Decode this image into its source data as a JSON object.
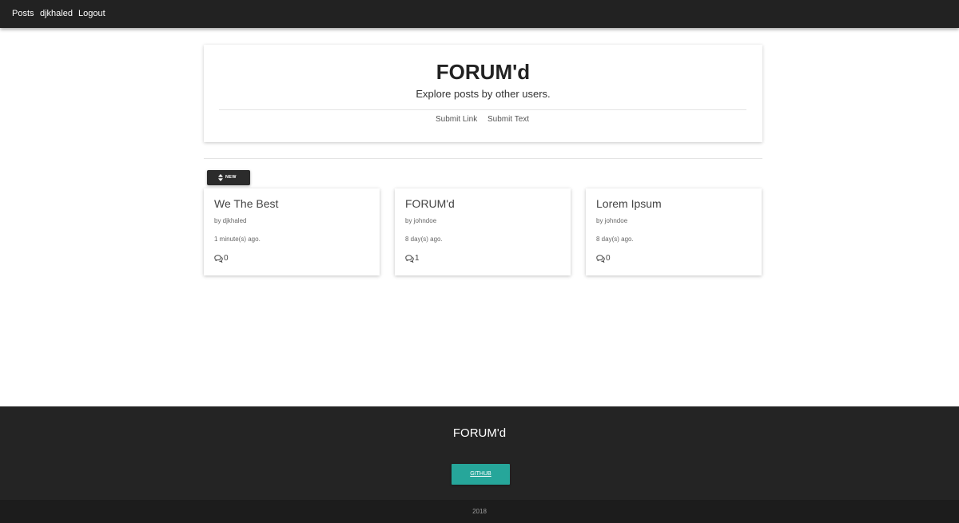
{
  "navbar": {
    "items": [
      {
        "label": "Posts"
      },
      {
        "label": "djkhaled"
      },
      {
        "label": "Logout"
      }
    ]
  },
  "hero": {
    "title": "FORUM'd",
    "subtitle": "Explore posts by other users.",
    "links": [
      {
        "label": "Submit Link"
      },
      {
        "label": "Submit Text"
      }
    ]
  },
  "sort": {
    "label": "NEW",
    "icon": "sort-icon"
  },
  "posts": [
    {
      "title": "We The Best",
      "author": "by djkhaled",
      "time": "1 minute(s) ago.",
      "comments": "0"
    },
    {
      "title": "FORUM'd",
      "author": "by johndoe",
      "time": "8 day(s) ago.",
      "comments": "1"
    },
    {
      "title": "Lorem Ipsum",
      "author": "by johndoe",
      "time": "8 day(s) ago.",
      "comments": "0"
    }
  ],
  "footer": {
    "title": "FORUM'd",
    "button_label": "GITHUB",
    "copyright": "2018"
  },
  "colors": {
    "navbar": "#222222",
    "footer": "#242424",
    "accent": "#26a69a"
  }
}
